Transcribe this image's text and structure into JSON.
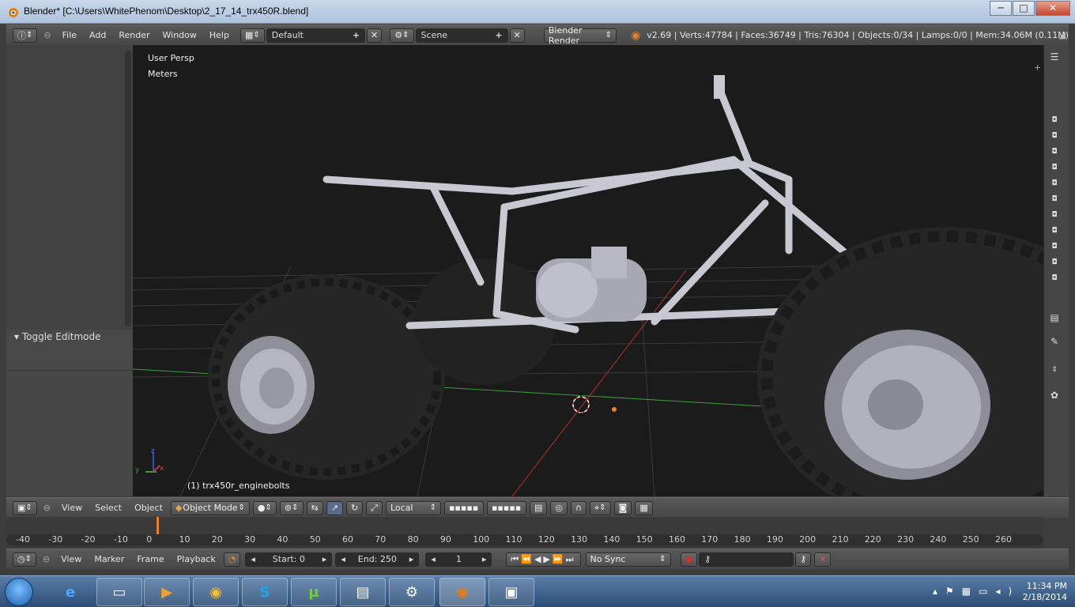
{
  "window": {
    "title": "Blender* [C:\\Users\\WhitePhenom\\Desktop\\2_17_14_trx450R.blend]",
    "minimize": "─",
    "maximize": "□",
    "close": "✕"
  },
  "topbar": {
    "menus": [
      "File",
      "Add",
      "Render",
      "Window",
      "Help"
    ],
    "layout": "Default",
    "scene": "Scene",
    "engine": "Blender Render",
    "stats": "v2.69 | Verts:47784 | Faces:36749 | Tris:76304 | Objects:0/34 | Lamps:0/0 | Mem:34.06M (0.11M)"
  },
  "left_panel": {
    "toggle_label": "Toggle Editmode"
  },
  "viewport": {
    "view_name": "User Persp",
    "units": "Meters",
    "active_object": "(1) trx450r_enginebolts",
    "axis_x": "x",
    "axis_y": "y",
    "axis_z": "z"
  },
  "view3d_header": {
    "menus": [
      "View",
      "Select",
      "Object"
    ],
    "mode": "Object Mode",
    "orientation": "Local"
  },
  "timeline": {
    "ticks": [
      "-40",
      "-30",
      "-20",
      "-10",
      "0",
      "10",
      "20",
      "30",
      "40",
      "50",
      "60",
      "70",
      "80",
      "90",
      "100",
      "110",
      "120",
      "130",
      "140",
      "150",
      "160",
      "170",
      "180",
      "190",
      "200",
      "210",
      "220",
      "230",
      "240",
      "250",
      "260"
    ],
    "current_frame_marker": 0
  },
  "timeline_header": {
    "menus": [
      "View",
      "Marker",
      "Frame",
      "Playback"
    ],
    "start": "Start: 0",
    "end": "End: 250",
    "current": "1",
    "sync": "No Sync"
  },
  "taskbar": {
    "time": "11:34 PM",
    "date": "2/18/2014",
    "apps": [
      "ie-icon",
      "explorer-icon",
      "media-icon",
      "chrome-icon",
      "skype-icon",
      "utorrent-icon",
      "control-panel-icon",
      "steam-icon",
      "blender-icon",
      "photo-icon"
    ]
  },
  "colors": {
    "accent": "#e8802d",
    "viewport_bg": "#1b1b1b",
    "grid_x": "#b23030",
    "grid_y": "#3aa03a"
  }
}
